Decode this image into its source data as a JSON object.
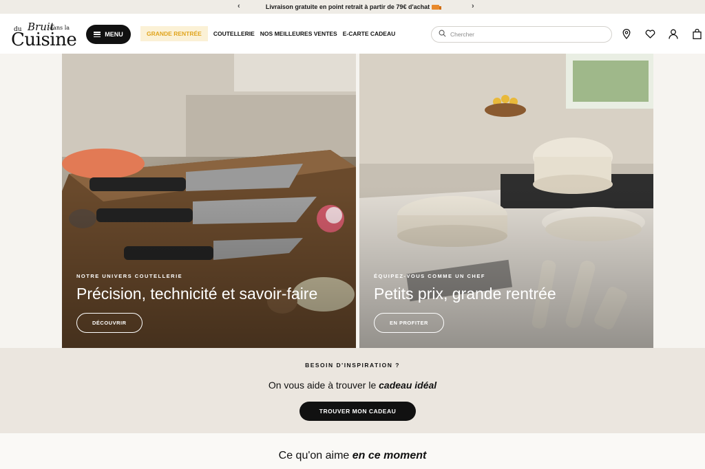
{
  "announcement": {
    "text": "Livraison gratuite en point retrait à partir de 79€ d'achat",
    "prev_icon": "chevron-left-icon",
    "next_icon": "chevron-right-icon"
  },
  "header": {
    "logo": {
      "du": "du",
      "bruit": "Bruit",
      "dans_la": "dans la",
      "cuisine": "Cuisine"
    },
    "menu_label": "MENU",
    "nav": [
      {
        "label": "GRANDE RENTRÉE",
        "highlight": true
      },
      {
        "label": "COUTELLERIE"
      },
      {
        "label": "NOS MEILLEURES VENTES"
      },
      {
        "label": "E-CARTE CADEAU"
      }
    ],
    "search_placeholder": "Chercher",
    "icons": [
      "location-pin-icon",
      "heart-icon",
      "user-icon",
      "bag-icon"
    ]
  },
  "hero": {
    "left": {
      "eyebrow": "NOTRE UNIVERS COUTELLERIE",
      "title": "Précision, technicité et savoir-faire",
      "button": "DÉCOUVRIR"
    },
    "right": {
      "eyebrow": "ÉQUIPEZ-VOUS COMME UN CHEF",
      "title": "Petits prix, grande rentrée",
      "button": "EN PROFITER"
    }
  },
  "inspiration": {
    "kicker": "BESOIN D'INSPIRATION ?",
    "line_prefix": "On vous aide à trouver le ",
    "line_em": "cadeau idéal",
    "button": "TROUVER MON CADEAU"
  },
  "moment": {
    "prefix": "Ce qu'on aime ",
    "em": "en ce moment"
  }
}
